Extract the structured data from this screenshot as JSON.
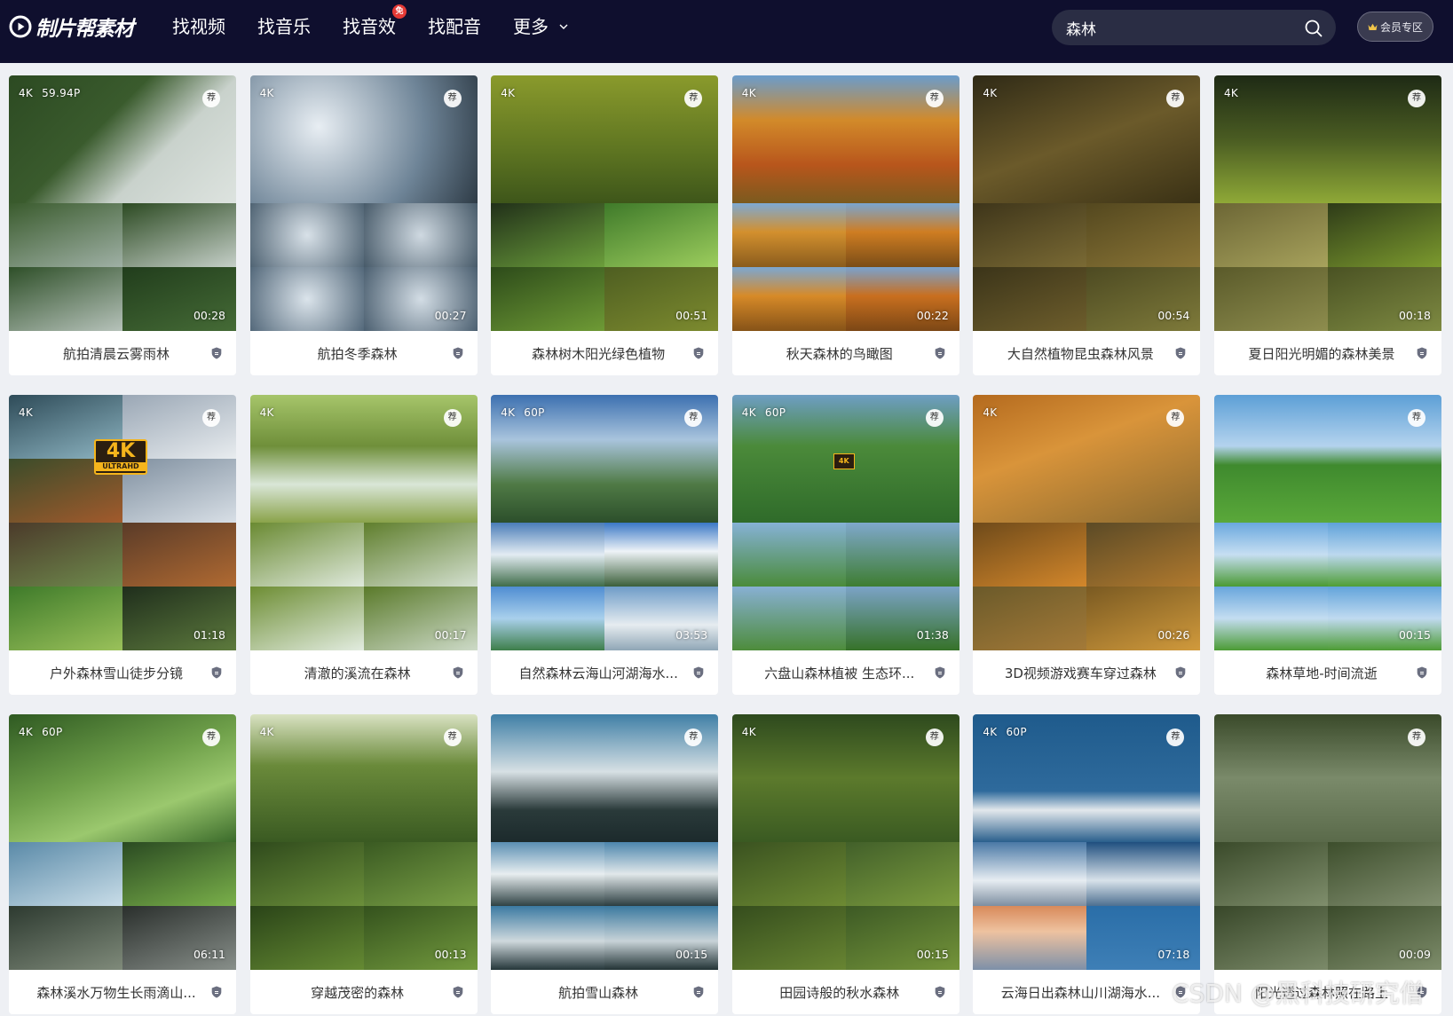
{
  "header": {
    "logo_text": "制片帮素材",
    "nav": [
      {
        "label": "找视频"
      },
      {
        "label": "找音乐"
      },
      {
        "label": "找音效",
        "badge": "免"
      },
      {
        "label": "找配音"
      },
      {
        "label": "更多"
      }
    ],
    "search_value": "森林",
    "vip_label": "会员专区"
  },
  "recommend_badge": "荐",
  "cards": [
    {
      "title": "航拍清晨云雾雨林",
      "tags": [
        "4K",
        "59.94P"
      ],
      "duration": "00:28"
    },
    {
      "title": "航拍冬季森林",
      "tags": [
        "4K"
      ],
      "duration": "00:27"
    },
    {
      "title": "森林树木阳光绿色植物",
      "tags": [
        "4K"
      ],
      "duration": "00:51"
    },
    {
      "title": "秋天森林的鸟瞰图",
      "tags": [
        "4K"
      ],
      "duration": "00:22"
    },
    {
      "title": "大自然植物昆虫森林风景",
      "tags": [
        "4K"
      ],
      "duration": "00:54"
    },
    {
      "title": "夏日阳光明媚的森林美景",
      "tags": [
        "4K"
      ],
      "duration": "00:18"
    },
    {
      "title": "户外森林雪山徒步分镜",
      "tags": [
        "4K"
      ],
      "duration": "01:18",
      "uhd": {
        "big": "4K",
        "small": "ULTRAHD"
      }
    },
    {
      "title": "清澈的溪流在森林",
      "tags": [
        "4K"
      ],
      "duration": "00:17"
    },
    {
      "title": "自然森林云海山河湖海水...",
      "tags": [
        "4K",
        "60P"
      ],
      "duration": "03:53"
    },
    {
      "title": "六盘山森林植被 生态环...",
      "tags": [
        "4K",
        "60P"
      ],
      "duration": "01:38",
      "uhd_mini": "4K"
    },
    {
      "title": "3D视频游戏赛车穿过森林",
      "tags": [
        "4K"
      ],
      "duration": "00:26"
    },
    {
      "title": "森林草地-时间流逝",
      "tags": [],
      "duration": "00:15"
    },
    {
      "title": "森林溪水万物生长雨滴山...",
      "tags": [
        "4K",
        "60P"
      ],
      "duration": "06:11"
    },
    {
      "title": "穿越茂密的森林",
      "tags": [
        "4K"
      ],
      "duration": "00:13"
    },
    {
      "title": "航拍雪山森林",
      "tags": [],
      "duration": "00:15"
    },
    {
      "title": "田园诗般的秋水森林",
      "tags": [
        "4K"
      ],
      "duration": "00:15"
    },
    {
      "title": "云海日出森林山川湖海水...",
      "tags": [
        "4K",
        "60P"
      ],
      "duration": "07:18"
    },
    {
      "title": "阳光透过森林照在路上",
      "tags": [],
      "duration": "00:09"
    }
  ],
  "watermark": "CSDN @黑科技研究僧",
  "colors": {
    "header_bg": "#0f0f2e",
    "search_bg": "#2a2d44",
    "page_bg": "#eef0f4",
    "badge_red": "#e53935",
    "uhd_gold": "#f5b51c"
  }
}
